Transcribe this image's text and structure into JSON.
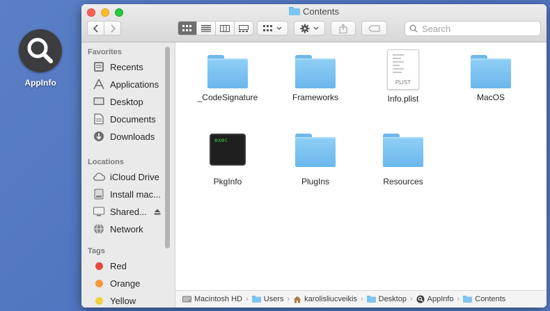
{
  "desktop": {
    "icon_label": "AppInfo"
  },
  "window": {
    "title": "Contents",
    "search_placeholder": "Search",
    "sidebar": {
      "favorites_header": "Favorites",
      "favorites": [
        "Recents",
        "Applications",
        "Desktop",
        "Documents",
        "Downloads"
      ],
      "locations_header": "Locations",
      "locations": [
        "iCloud Drive",
        "Install mac...",
        "Shared...",
        "Network"
      ],
      "tags_header": "Tags",
      "tags": [
        {
          "label": "Red",
          "color": "#e5483f"
        },
        {
          "label": "Orange",
          "color": "#f49a3a"
        },
        {
          "label": "Yellow",
          "color": "#f2cf3c"
        }
      ]
    },
    "files": {
      "codesignature": "_CodeSignature",
      "frameworks": "Frameworks",
      "info_plist": "Info.plist",
      "plist_badge": "PLIST",
      "macos": "MacOS",
      "pkginfo": "PkgInfo",
      "exec_text": "exec",
      "plugins": "PlugIns",
      "resources": "Resources"
    },
    "path": [
      "Macintosh HD",
      "Users",
      "karolisliucveikis",
      "Desktop",
      "AppInfo",
      "Contents"
    ]
  },
  "colors": {
    "folder": "#6ab7ec",
    "close": "#fd5f57",
    "minimize": "#febc2e",
    "zoom": "#28c840"
  }
}
